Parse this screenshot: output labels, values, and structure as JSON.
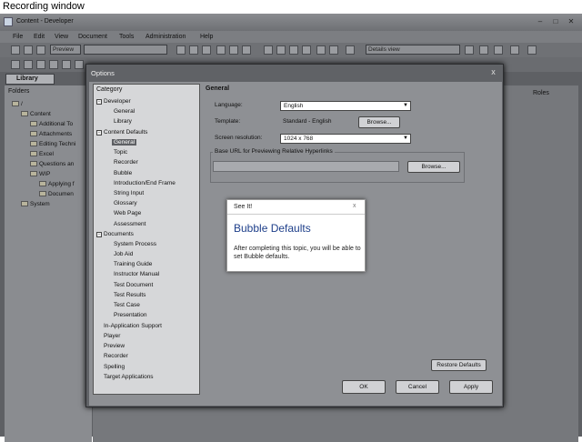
{
  "recording_window": {
    "title": "Recording window"
  },
  "app": {
    "title": "Content - Developer",
    "menu": [
      "File",
      "Edit",
      "View",
      "Document",
      "Tools",
      "Administration",
      "Help"
    ],
    "toolbar": {
      "preview_label": "Preview",
      "view_select": "Details view"
    },
    "library_tab": "Library",
    "folders_label": "Folders",
    "tree": [
      "/",
      "Content",
      "Additional To",
      "Attachments",
      "Editing Techni",
      "Excel",
      "Questions an",
      "WIP",
      "Applying f",
      "Documen",
      "System"
    ],
    "roles_header": "Roles"
  },
  "dialog": {
    "title": "Options",
    "close_glyph": "x",
    "category_header": "Category",
    "categories": [
      {
        "label": "Developer",
        "group": true
      },
      {
        "label": "General"
      },
      {
        "label": "Library"
      },
      {
        "label": "Content Defaults",
        "group": true
      },
      {
        "label": "General",
        "selected": true
      },
      {
        "label": "Topic"
      },
      {
        "label": "Recorder"
      },
      {
        "label": "Bubble"
      },
      {
        "label": "Introduction/End Frame"
      },
      {
        "label": "String Input"
      },
      {
        "label": "Glossary"
      },
      {
        "label": "Web Page"
      },
      {
        "label": "Assessment"
      },
      {
        "label": "Documents",
        "group": true
      },
      {
        "label": "System Process"
      },
      {
        "label": "Job Aid"
      },
      {
        "label": "Training Guide"
      },
      {
        "label": "Instructor Manual"
      },
      {
        "label": "Test Document"
      },
      {
        "label": "Test Results"
      },
      {
        "label": "Test Case"
      },
      {
        "label": "Presentation"
      },
      {
        "label": "In-Application Support",
        "root": true
      },
      {
        "label": "Player",
        "root": true
      },
      {
        "label": "Preview",
        "root": true
      },
      {
        "label": "Recorder",
        "root": true
      },
      {
        "label": "Spelling",
        "root": true
      },
      {
        "label": "Target Applications",
        "root": true
      }
    ],
    "general": {
      "title": "General",
      "language_label": "Language:",
      "language_value": "English",
      "template_label": "Template:",
      "template_value": "Standard - English",
      "browse_label": "Browse...",
      "resolution_label": "Screen resolution:",
      "resolution_value": "1024 x 768",
      "base_url_label": "Base URL for Previewing Relative Hyperlinks",
      "base_url_value": "",
      "browse2_label": "Browse...",
      "restore_label": "Restore Defaults"
    },
    "buttons": {
      "ok": "OK",
      "cancel": "Cancel",
      "apply": "Apply"
    }
  },
  "popup": {
    "title": "See It!",
    "close_glyph": "x",
    "heading": "Bubble Defaults",
    "body": "After completing this topic, you will be able to set Bubble defaults."
  }
}
